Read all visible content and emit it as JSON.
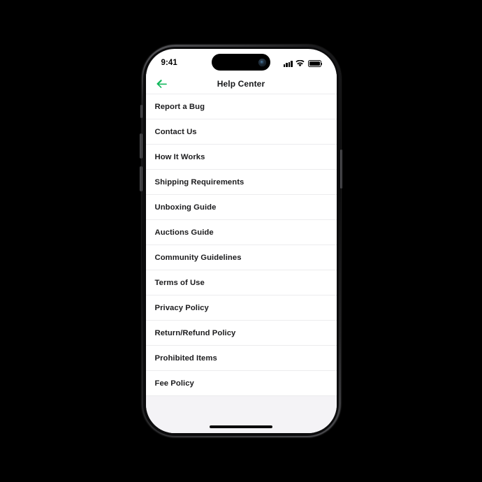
{
  "device": {
    "frame_color": "#0a0a0b",
    "screen_background": "#ffffff"
  },
  "status_bar": {
    "time": "9:41",
    "signal_icon": "cellular-signal-icon",
    "wifi_icon": "wifi-icon",
    "battery_icon": "battery-full-icon",
    "dynamic_island": "dynamic-island",
    "camera_icon": "front-camera-lens"
  },
  "header": {
    "back_icon": "arrow-left-icon",
    "back_color": "#12b85c",
    "title": "Help Center"
  },
  "list": {
    "items": [
      {
        "label": "Report a Bug"
      },
      {
        "label": "Contact Us"
      },
      {
        "label": "How It Works"
      },
      {
        "label": "Shipping Requirements"
      },
      {
        "label": "Unboxing Guide"
      },
      {
        "label": "Auctions Guide"
      },
      {
        "label": "Community Guidelines"
      },
      {
        "label": "Terms of Use"
      },
      {
        "label": "Privacy Policy"
      },
      {
        "label": "Return/Refund Policy"
      },
      {
        "label": "Prohibited Items"
      },
      {
        "label": "Fee Policy"
      }
    ]
  },
  "footer": {
    "background": "#f4f3f6",
    "home_indicator": "home-indicator"
  },
  "colors": {
    "accent_green": "#12b85c",
    "text_primary": "#1c1c1e",
    "divider": "#ececee",
    "page_background": "#000000"
  }
}
